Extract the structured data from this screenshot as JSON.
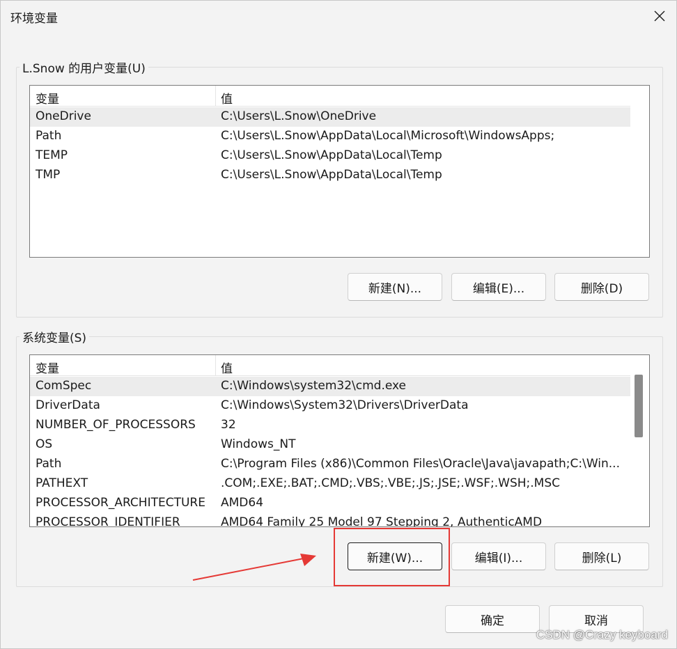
{
  "window": {
    "title": "环境变量",
    "close_icon": "close-icon"
  },
  "user_vars": {
    "legend": "L.Snow 的用户变量(U)",
    "columns": {
      "name": "变量",
      "value": "值"
    },
    "rows": [
      {
        "name": "OneDrive",
        "value": "C:\\Users\\L.Snow\\OneDrive"
      },
      {
        "name": "Path",
        "value": "C:\\Users\\L.Snow\\AppData\\Local\\Microsoft\\WindowsApps;"
      },
      {
        "name": "TEMP",
        "value": "C:\\Users\\L.Snow\\AppData\\Local\\Temp"
      },
      {
        "name": "TMP",
        "value": "C:\\Users\\L.Snow\\AppData\\Local\\Temp"
      }
    ],
    "buttons": {
      "new": "新建(N)...",
      "edit": "编辑(E)...",
      "delete": "删除(D)"
    }
  },
  "system_vars": {
    "legend": "系统变量(S)",
    "columns": {
      "name": "变量",
      "value": "值"
    },
    "rows": [
      {
        "name": "ComSpec",
        "value": "C:\\Windows\\system32\\cmd.exe"
      },
      {
        "name": "DriverData",
        "value": "C:\\Windows\\System32\\Drivers\\DriverData"
      },
      {
        "name": "NUMBER_OF_PROCESSORS",
        "value": "32"
      },
      {
        "name": "OS",
        "value": "Windows_NT"
      },
      {
        "name": "Path",
        "value": "C:\\Program Files (x86)\\Common Files\\Oracle\\Java\\javapath;C:\\Win..."
      },
      {
        "name": "PATHEXT",
        "value": ".COM;.EXE;.BAT;.CMD;.VBS;.VBE;.JS;.JSE;.WSF;.WSH;.MSC"
      },
      {
        "name": "PROCESSOR_ARCHITECTURE",
        "value": "AMD64"
      },
      {
        "name": "PROCESSOR_IDENTIFIER",
        "value": "AMD64 Family 25 Model 97 Stepping 2, AuthenticAMD"
      }
    ],
    "buttons": {
      "new": "新建(W)...",
      "edit": "编辑(I)...",
      "delete": "删除(L)"
    }
  },
  "footer": {
    "ok": "确定",
    "cancel": "取消"
  },
  "annotation": {
    "highlight_color": "#e53935"
  },
  "watermark": "CSDN @Crazy keyboard"
}
